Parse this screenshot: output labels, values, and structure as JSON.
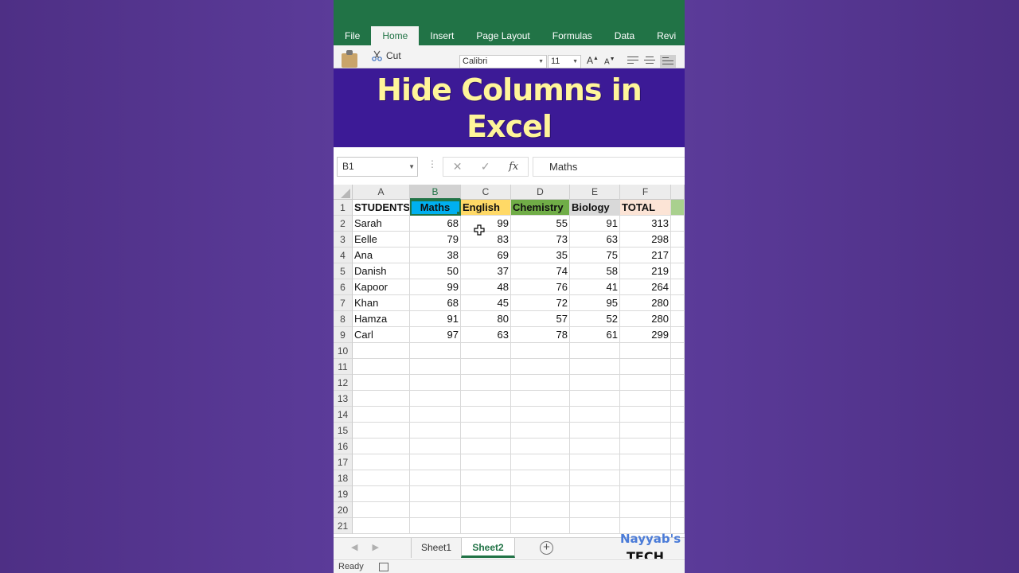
{
  "ribbon": {
    "tabs": [
      "File",
      "Home",
      "Insert",
      "Page Layout",
      "Formulas",
      "Data",
      "Revi"
    ],
    "active_tab": "Home",
    "cut_label": "Cut",
    "font_name": "Calibri",
    "font_size": "11",
    "grow_label": "A",
    "shrink_label": "A"
  },
  "banner": {
    "line1": "Hide Columns in",
    "line2": "Excel"
  },
  "formula_bar": {
    "name_box": "B1",
    "fx_label": "fx",
    "cancel_glyph": "✕",
    "enter_glyph": "✓",
    "content": "Maths"
  },
  "columns": [
    "A",
    "B",
    "C",
    "D",
    "E",
    "F"
  ],
  "selected_column": "B",
  "header_row": [
    {
      "text": "STUDENTS",
      "bg": "#ffffff"
    },
    {
      "text": "Maths",
      "bg": "#00b0f0"
    },
    {
      "text": "English",
      "bg": "#ffd966"
    },
    {
      "text": "Chemistry",
      "bg": "#70ad47"
    },
    {
      "text": "Biology",
      "bg": "#d9d9d9"
    },
    {
      "text": "TOTAL",
      "bg": "#fce4d6"
    }
  ],
  "rows": [
    [
      "Sarah",
      "68",
      "99",
      "55",
      "91",
      "313"
    ],
    [
      "Eelle",
      "79",
      "83",
      "73",
      "63",
      "298"
    ],
    [
      "Ana",
      "38",
      "69",
      "35",
      "75",
      "217"
    ],
    [
      "Danish",
      "50",
      "37",
      "74",
      "58",
      "219"
    ],
    [
      "Kapoor",
      "99",
      "48",
      "76",
      "41",
      "264"
    ],
    [
      "Khan",
      "68",
      "45",
      "72",
      "95",
      "280"
    ],
    [
      "Hamza",
      "91",
      "80",
      "57",
      "52",
      "280"
    ],
    [
      "Carl",
      "97",
      "63",
      "78",
      "61",
      "299"
    ]
  ],
  "row_numbers": [
    "1",
    "2",
    "3",
    "4",
    "5",
    "6",
    "7",
    "8",
    "9",
    "10",
    "11",
    "12",
    "13",
    "14",
    "15",
    "16",
    "17",
    "18",
    "19",
    "20",
    "21"
  ],
  "sheets": {
    "sheet1": "Sheet1",
    "sheet2": "Sheet2",
    "active": "Sheet2",
    "add_glyph": "+"
  },
  "watermark": {
    "line1": "Nayyab's",
    "line2": "TECH"
  },
  "status": {
    "text": "Ready"
  },
  "colors": {
    "excel_green": "#217346",
    "banner_bg": "#3c1a96",
    "banner_text": "#fff59a",
    "page_bg": "#5b3a96"
  }
}
